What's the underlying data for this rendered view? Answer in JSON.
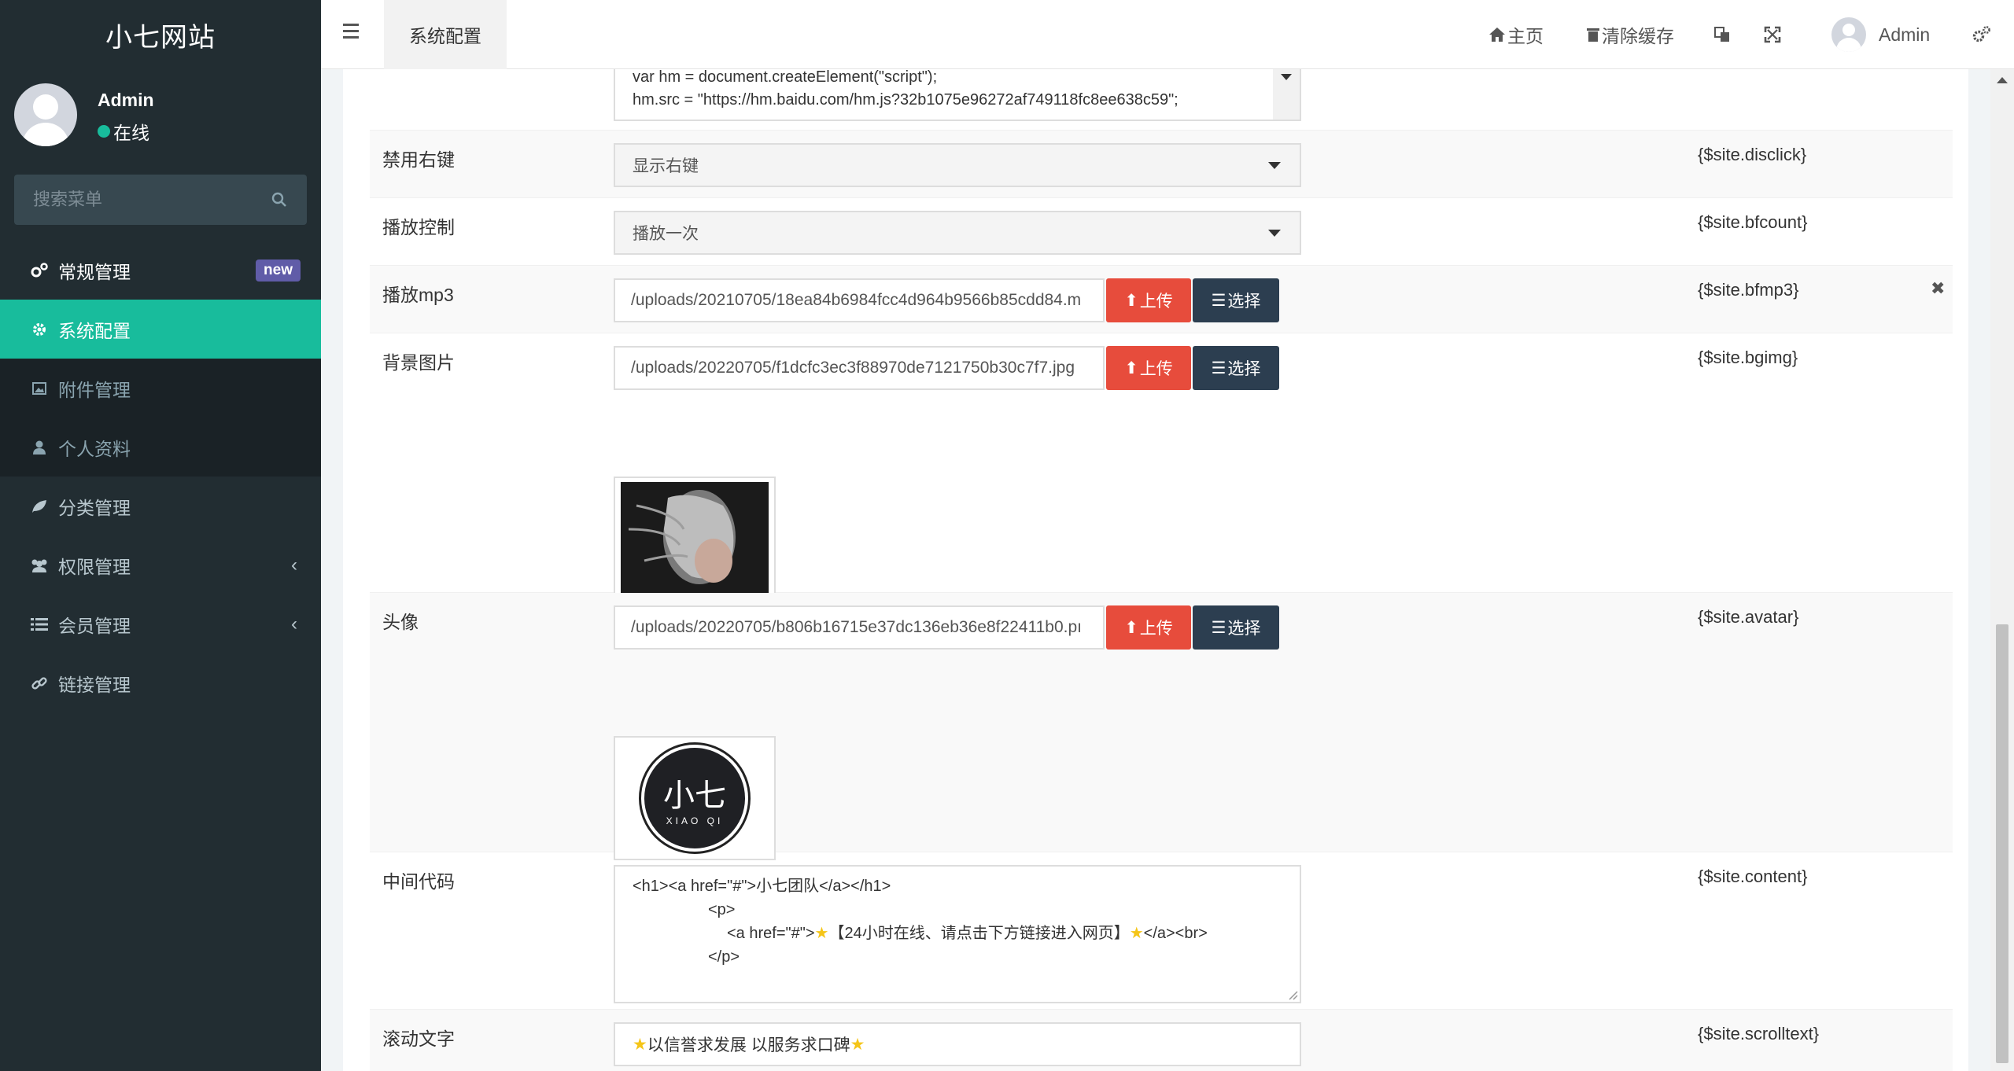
{
  "sidebar": {
    "logo": "小七网站",
    "user": {
      "name": "Admin",
      "status": "在线"
    },
    "search_placeholder": "搜索菜单",
    "items": [
      {
        "label": "常规管理",
        "icon": "cogs-icon",
        "badge": "new"
      },
      {
        "label": "系统配置",
        "icon": "gear-icon",
        "active": true
      },
      {
        "label": "附件管理",
        "icon": "image-icon",
        "sub": true
      },
      {
        "label": "个人资料",
        "icon": "user-icon",
        "sub": true
      },
      {
        "label": "分类管理",
        "icon": "leaf-icon"
      },
      {
        "label": "权限管理",
        "icon": "group-icon",
        "caret": "‹"
      },
      {
        "label": "会员管理",
        "icon": "list-icon",
        "caret": "‹"
      },
      {
        "label": "链接管理",
        "icon": "link-icon"
      }
    ]
  },
  "header": {
    "active_tab": "系统配置",
    "home": "主页",
    "clear_cache": "清除缓存",
    "user": "Admin"
  },
  "form": {
    "top_code": {
      "line1": "var hm = document.createElement(\"script\");",
      "line2": "hm.src = \"https://hm.baidu.com/hm.js?32b1075e96272af749118fc8ee638c59\";"
    },
    "disclick": {
      "label": "禁用右键",
      "value": "显示右键",
      "var": "{$site.disclick}"
    },
    "bfcount": {
      "label": "播放控制",
      "value": "播放一次",
      "var": "{$site.bfcount}"
    },
    "bfmp3": {
      "label": "播放mp3",
      "value": "/uploads/20210705/18ea84b6984fcc4d964b9566b85cdd84.m",
      "var": "{$site.bfmp3}",
      "remove": "✖"
    },
    "bgimg": {
      "label": "背景图片",
      "value": "/uploads/20220705/f1dcfc3ec3f88970de7121750b30c7f7.jpg",
      "var": "{$site.bgimg}"
    },
    "avatar": {
      "label": "头像",
      "value": "/uploads/20220705/b806b16715e37dc136eb36e8f22411b0.pı",
      "var": "{$site.avatar}",
      "logo_text": "小七",
      "logo_sub": "XIAO QI"
    },
    "content": {
      "label": "中间代码",
      "var": "{$site.content}",
      "line1": "<h1><a href=\"#\">小七团队</a></h1>",
      "line2": "<p>",
      "line3_a": "<a href=\"#\">",
      "line3_b": "【24小时在线、请点击下方链接进入网页】",
      "line3_c": "</a><br>",
      "line4": "</p>"
    },
    "scrolltext": {
      "label": "滚动文字",
      "value": "以信誉求发展 以服务求口碑",
      "var": "{$site.scrolltext}"
    },
    "upload_label": "上传",
    "choose_label": "选择"
  }
}
